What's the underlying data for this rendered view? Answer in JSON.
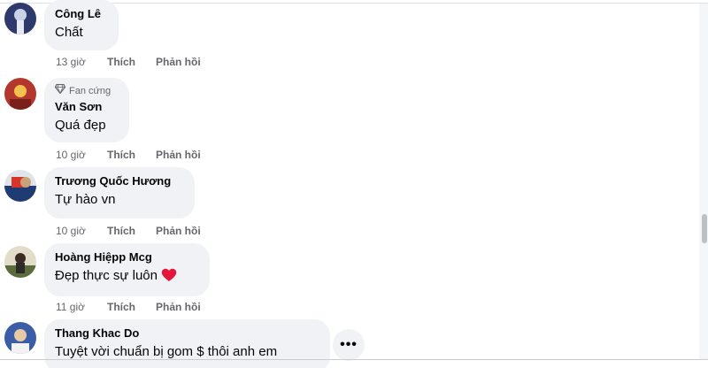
{
  "comments": [
    {
      "author": "Công Lê",
      "text": "Chất",
      "time": "13 giờ",
      "like_label": "Thích",
      "reply_label": "Phản hồi",
      "avatar_colors": [
        "#2d3a6b",
        "#c9d2e8"
      ]
    },
    {
      "badge": "Fan cứng",
      "author": "Văn Sơn",
      "text": "Quá đẹp",
      "time": "10 giờ",
      "like_label": "Thích",
      "reply_label": "Phản hồi",
      "avatar_colors": [
        "#b4372d",
        "#f2c14e"
      ]
    },
    {
      "author": "Trương Quốc Hương",
      "text": "Tự hào vn",
      "time": "10 giờ",
      "like_label": "Thích",
      "reply_label": "Phản hồi",
      "avatar_colors": [
        "#1f3b73",
        "#d9342b"
      ]
    },
    {
      "author": "Hoàng Hiệpp Mcg",
      "text": "Đẹp thực sự luôn",
      "time": "11 giờ",
      "like_label": "Thích",
      "reply_label": "Phản hồi",
      "avatar_colors": [
        "#5a6b3c",
        "#e4dccb"
      ]
    },
    {
      "author": "Thang Khac Do",
      "text": "Tuyệt vời chuẩn bị gom $ thôi anh em",
      "avatar_colors": [
        "#3b5da8",
        "#e8c9a5"
      ]
    }
  ],
  "more_button": "•••",
  "colors": {
    "bubble": "#f0f2f5",
    "secondary_text": "#65676b",
    "heart": "#e4163a"
  },
  "icons": {
    "badge": "diamond-icon",
    "reaction": "heart-icon",
    "more": "more-options-icon"
  }
}
